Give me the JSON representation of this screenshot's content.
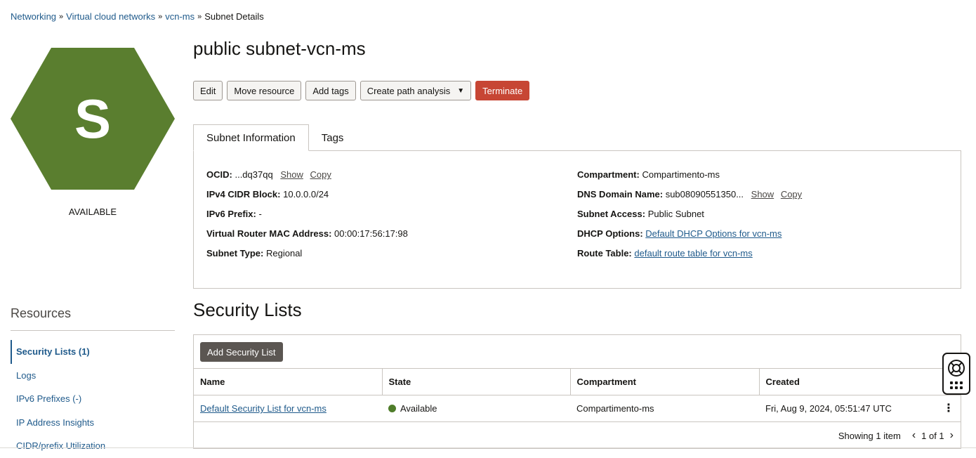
{
  "breadcrumb": {
    "items": [
      "Networking",
      "Virtual cloud networks",
      "vcn-ms"
    ],
    "current": "Subnet Details",
    "separator": "»"
  },
  "resource_badge": {
    "letter": "S",
    "status": "AVAILABLE",
    "color": "#5a7e2f"
  },
  "page": {
    "title": "public subnet-vcn-ms"
  },
  "actions": {
    "edit": "Edit",
    "move": "Move resource",
    "add_tags": "Add tags",
    "path_analysis": "Create path analysis",
    "terminate": "Terminate",
    "terminate_color": "#c74634"
  },
  "tabs": [
    "Subnet Information",
    "Tags"
  ],
  "info": {
    "ocid_label": "OCID:",
    "ocid_value": "...dq37qq",
    "show": "Show",
    "copy": "Copy",
    "ipv4_label": "IPv4 CIDR Block:",
    "ipv4_value": "10.0.0.0/24",
    "ipv6_label": "IPv6 Prefix:",
    "ipv6_value": "-",
    "mac_label": "Virtual Router MAC Address:",
    "mac_value": "00:00:17:56:17:98",
    "type_label": "Subnet Type:",
    "type_value": "Regional",
    "compartment_label": "Compartment:",
    "compartment_value": "Compartimento-ms",
    "dns_label": "DNS Domain Name:",
    "dns_value": "sub08090551350...",
    "access_label": "Subnet Access:",
    "access_value": "Public Subnet",
    "dhcp_label": "DHCP Options:",
    "dhcp_value": "Default DHCP Options for vcn-ms",
    "route_label": "Route Table:",
    "route_value": "default route table for vcn-ms"
  },
  "resources": {
    "title": "Resources",
    "items": [
      "Security Lists (1)",
      "Logs",
      "IPv6 Prefixes (-)",
      "IP Address Insights",
      "CIDR/prefix Utilization"
    ]
  },
  "security_lists": {
    "title": "Security Lists",
    "add_button": "Add Security List",
    "columns": [
      "Name",
      "State",
      "Compartment",
      "Created"
    ],
    "rows": [
      {
        "name": "Default Security List for vcn-ms",
        "state": "Available",
        "compartment": "Compartimento-ms",
        "created": "Fri, Aug 9, 2024, 05:51:47 UTC"
      }
    ],
    "showing": "Showing",
    "count": "1",
    "item_word": "item",
    "page": "1 of 1",
    "state_color": "#4f7d2a"
  },
  "icons": {
    "lifebuoy": "lifebuoy-icon",
    "apps": "apps-grid-icon",
    "caret": "caret-down-icon",
    "kebab": "kebab-menu-icon"
  }
}
